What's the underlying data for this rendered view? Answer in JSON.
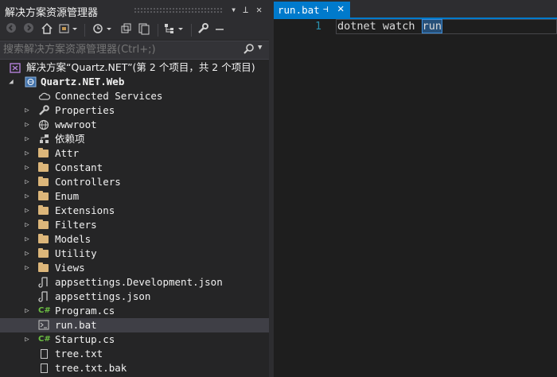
{
  "solution_explorer": {
    "title": "解决方案资源管理器",
    "title_buttons": {
      "dropdown": "▾",
      "pin": "⊥",
      "close": "✕"
    },
    "search_placeholder": "搜索解决方案资源管理器(Ctrl+;)",
    "tree": [
      {
        "label": "解决方案“Quartz.NET”(第 2 个项目，共 2 个项目)",
        "icon": "solution-icon",
        "expander": "",
        "indent": 0,
        "bold": false
      },
      {
        "label": "Quartz.NET.Web",
        "icon": "web-project-icon",
        "expander": "expanded",
        "indent": 1,
        "bold": true
      },
      {
        "label": "Connected Services",
        "icon": "cloud-icon",
        "expander": "",
        "indent": 2
      },
      {
        "label": "Properties",
        "icon": "wrench-icon",
        "expander": "collapsed",
        "indent": 2
      },
      {
        "label": "wwwroot",
        "icon": "globe-icon",
        "expander": "collapsed",
        "indent": 2
      },
      {
        "label": "依赖项",
        "icon": "dependencies-icon",
        "expander": "collapsed",
        "indent": 2
      },
      {
        "label": "Attr",
        "icon": "folder-icon",
        "expander": "collapsed",
        "indent": 2
      },
      {
        "label": "Constant",
        "icon": "folder-icon",
        "expander": "collapsed",
        "indent": 2
      },
      {
        "label": "Controllers",
        "icon": "folder-icon",
        "expander": "collapsed",
        "indent": 2
      },
      {
        "label": "Enum",
        "icon": "folder-icon",
        "expander": "collapsed",
        "indent": 2
      },
      {
        "label": "Extensions",
        "icon": "folder-icon",
        "expander": "collapsed",
        "indent": 2
      },
      {
        "label": "Filters",
        "icon": "folder-icon",
        "expander": "collapsed",
        "indent": 2
      },
      {
        "label": "Models",
        "icon": "folder-icon",
        "expander": "collapsed",
        "indent": 2
      },
      {
        "label": "Utility",
        "icon": "folder-icon",
        "expander": "collapsed",
        "indent": 2
      },
      {
        "label": "Views",
        "icon": "folder-icon",
        "expander": "collapsed",
        "indent": 2
      },
      {
        "label": "appsettings.Development.json",
        "icon": "json-file-icon",
        "expander": "",
        "indent": 2
      },
      {
        "label": "appsettings.json",
        "icon": "json-file-icon",
        "expander": "",
        "indent": 2
      },
      {
        "label": "Program.cs",
        "icon": "csharp-file-icon",
        "expander": "collapsed",
        "indent": 2
      },
      {
        "label": "run.bat",
        "icon": "batch-file-icon",
        "expander": "",
        "indent": 2,
        "selected": true
      },
      {
        "label": "Startup.cs",
        "icon": "csharp-file-icon",
        "expander": "collapsed",
        "indent": 2
      },
      {
        "label": "tree.txt",
        "icon": "text-file-icon",
        "expander": "",
        "indent": 2
      },
      {
        "label": "tree.txt.bak",
        "icon": "text-file-icon",
        "expander": "",
        "indent": 2
      }
    ]
  },
  "editor": {
    "tab": {
      "label": "run.bat",
      "pin": "⊣",
      "close": "✕"
    },
    "lines": [
      {
        "number": "1",
        "text_before": "dotnet watch ",
        "highlighted": "run"
      }
    ]
  },
  "colors": {
    "accent": "#007acc",
    "folder": "#dcb67a",
    "line_number": "#2b91af",
    "csharp": "#6cbf43"
  }
}
